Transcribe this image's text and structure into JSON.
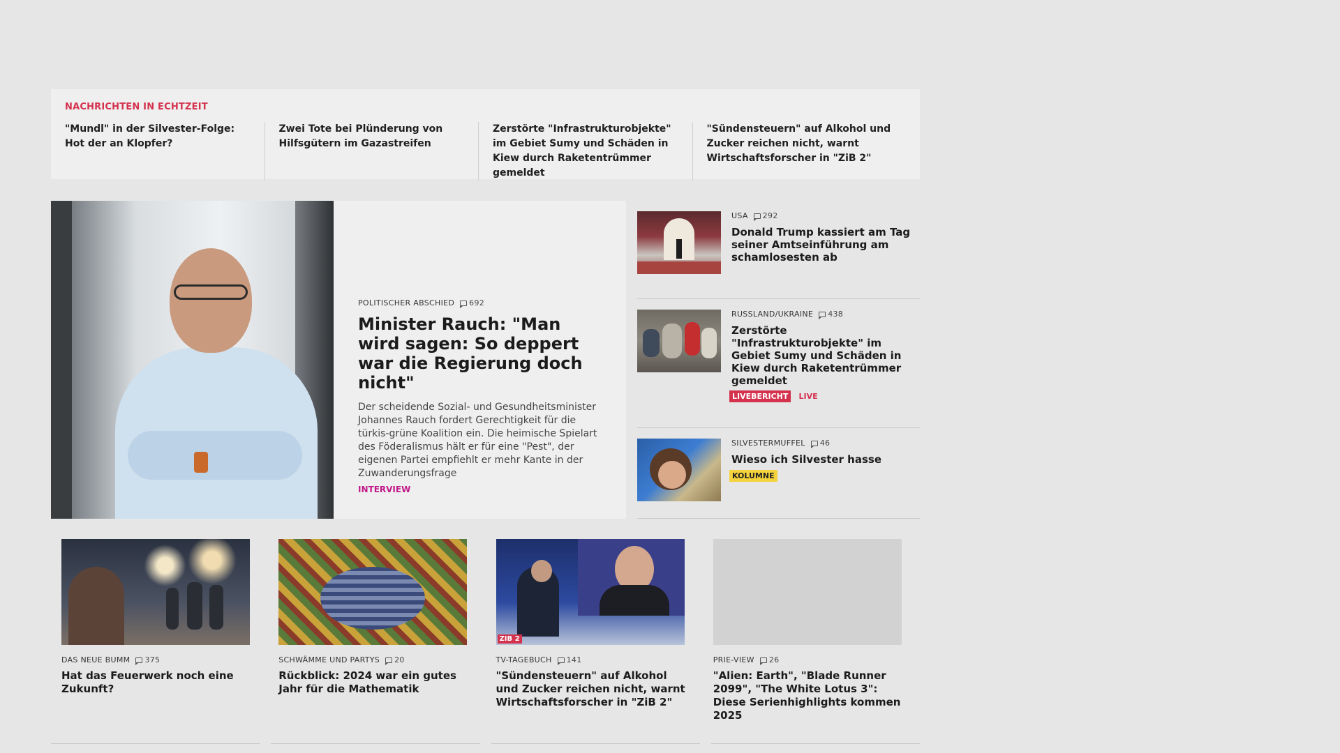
{
  "ticker": {
    "heading": "NACHRICHTEN IN ECHTZEIT",
    "items": [
      "\"Mundl\" in der Silvester-Folge: Hot der an Klopfer?",
      "Zwei Tote bei Plünderung von Hilfsgü­tern im Gazastreifen",
      "Zerstörte \"Infrastrukturobjekte\" im Gebiet Sumy und Schäden in Kiew durch Raketentrümmer gemeldet",
      "\"Sündensteuern\" auf Alkohol und Zu­cker reichen nicht, warnt Wirtschafts­forscher in \"ZiB 2\""
    ]
  },
  "lead": {
    "kicker": "POLITISCHER ABSCHIED",
    "comments": "692",
    "title": "Minister Rauch: \"Man wird sagen: So deppert war die Regierung doch nicht\"",
    "description": "Der scheidende Sozial- und Gesundheitsminister Johannes Rauch fordert Gerechtigkeit für die türkis-grüne Koalition ein. Die heimische Spielart des Föderalismus hält er für eine \"Pest\", der eigenen Partei empfiehlt er mehr Kante in der Zuwande­rungsfrage",
    "tag": "INTERVIEW"
  },
  "side": [
    {
      "kicker": "USA",
      "comments": "292",
      "title": "Donald Trump kassiert am Tag seiner Amtseinführung am schamlosesten ab"
    },
    {
      "kicker": "RUSSLAND/UKRAINE",
      "comments": "438",
      "title": "Zerstörte \"Infrastrukturobjekte\" im Gebiet Sumy und Schäden in Kiew durch Raketentrümmer gemeldet",
      "badge": "LIVEBERICHT",
      "badge2": "LIVE"
    },
    {
      "kicker": "SILVESTERMUFFEL",
      "comments": "46",
      "title": "Wieso ich Silvester hasse",
      "badge": "KOLUMNE"
    }
  ],
  "cards": [
    {
      "kicker": "DAS NEUE BUMM",
      "comments": "375",
      "title": "Hat das Feuerwerk noch eine Zukunft?"
    },
    {
      "kicker": "SCHWÄMME UND PARTYS",
      "comments": "20",
      "title": "Rückblick: 2024 war ein gutes Jahr für die Mathematik"
    },
    {
      "kicker": "TV-TAGEBUCH",
      "comments": "141",
      "title": "\"Sündensteuern\" auf Alkohol und Zucker reichen nicht, warnt Wirt­schaftsforscher in \"ZiB 2\"",
      "logo": "ZIB 2"
    },
    {
      "kicker": "PRIE-VIEW",
      "comments": "26",
      "title": "\"Alien: Earth\", \"Blade Runner 2099\", \"The White Lotus 3\": Diese Serienhighlights kommen 2025"
    }
  ]
}
